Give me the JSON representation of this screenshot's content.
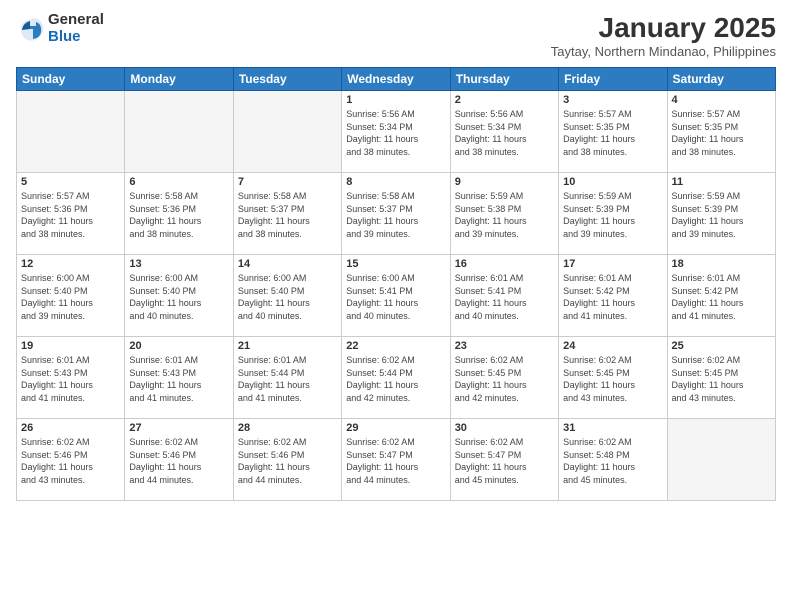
{
  "header": {
    "logo_general": "General",
    "logo_blue": "Blue",
    "month_title": "January 2025",
    "location": "Taytay, Northern Mindanao, Philippines"
  },
  "weekdays": [
    "Sunday",
    "Monday",
    "Tuesday",
    "Wednesday",
    "Thursday",
    "Friday",
    "Saturday"
  ],
  "weeks": [
    [
      {
        "day": "",
        "info": ""
      },
      {
        "day": "",
        "info": ""
      },
      {
        "day": "",
        "info": ""
      },
      {
        "day": "1",
        "info": "Sunrise: 5:56 AM\nSunset: 5:34 PM\nDaylight: 11 hours\nand 38 minutes."
      },
      {
        "day": "2",
        "info": "Sunrise: 5:56 AM\nSunset: 5:34 PM\nDaylight: 11 hours\nand 38 minutes."
      },
      {
        "day": "3",
        "info": "Sunrise: 5:57 AM\nSunset: 5:35 PM\nDaylight: 11 hours\nand 38 minutes."
      },
      {
        "day": "4",
        "info": "Sunrise: 5:57 AM\nSunset: 5:35 PM\nDaylight: 11 hours\nand 38 minutes."
      }
    ],
    [
      {
        "day": "5",
        "info": "Sunrise: 5:57 AM\nSunset: 5:36 PM\nDaylight: 11 hours\nand 38 minutes."
      },
      {
        "day": "6",
        "info": "Sunrise: 5:58 AM\nSunset: 5:36 PM\nDaylight: 11 hours\nand 38 minutes."
      },
      {
        "day": "7",
        "info": "Sunrise: 5:58 AM\nSunset: 5:37 PM\nDaylight: 11 hours\nand 38 minutes."
      },
      {
        "day": "8",
        "info": "Sunrise: 5:58 AM\nSunset: 5:37 PM\nDaylight: 11 hours\nand 39 minutes."
      },
      {
        "day": "9",
        "info": "Sunrise: 5:59 AM\nSunset: 5:38 PM\nDaylight: 11 hours\nand 39 minutes."
      },
      {
        "day": "10",
        "info": "Sunrise: 5:59 AM\nSunset: 5:39 PM\nDaylight: 11 hours\nand 39 minutes."
      },
      {
        "day": "11",
        "info": "Sunrise: 5:59 AM\nSunset: 5:39 PM\nDaylight: 11 hours\nand 39 minutes."
      }
    ],
    [
      {
        "day": "12",
        "info": "Sunrise: 6:00 AM\nSunset: 5:40 PM\nDaylight: 11 hours\nand 39 minutes."
      },
      {
        "day": "13",
        "info": "Sunrise: 6:00 AM\nSunset: 5:40 PM\nDaylight: 11 hours\nand 40 minutes."
      },
      {
        "day": "14",
        "info": "Sunrise: 6:00 AM\nSunset: 5:40 PM\nDaylight: 11 hours\nand 40 minutes."
      },
      {
        "day": "15",
        "info": "Sunrise: 6:00 AM\nSunset: 5:41 PM\nDaylight: 11 hours\nand 40 minutes."
      },
      {
        "day": "16",
        "info": "Sunrise: 6:01 AM\nSunset: 5:41 PM\nDaylight: 11 hours\nand 40 minutes."
      },
      {
        "day": "17",
        "info": "Sunrise: 6:01 AM\nSunset: 5:42 PM\nDaylight: 11 hours\nand 41 minutes."
      },
      {
        "day": "18",
        "info": "Sunrise: 6:01 AM\nSunset: 5:42 PM\nDaylight: 11 hours\nand 41 minutes."
      }
    ],
    [
      {
        "day": "19",
        "info": "Sunrise: 6:01 AM\nSunset: 5:43 PM\nDaylight: 11 hours\nand 41 minutes."
      },
      {
        "day": "20",
        "info": "Sunrise: 6:01 AM\nSunset: 5:43 PM\nDaylight: 11 hours\nand 41 minutes."
      },
      {
        "day": "21",
        "info": "Sunrise: 6:01 AM\nSunset: 5:44 PM\nDaylight: 11 hours\nand 41 minutes."
      },
      {
        "day": "22",
        "info": "Sunrise: 6:02 AM\nSunset: 5:44 PM\nDaylight: 11 hours\nand 42 minutes."
      },
      {
        "day": "23",
        "info": "Sunrise: 6:02 AM\nSunset: 5:45 PM\nDaylight: 11 hours\nand 42 minutes."
      },
      {
        "day": "24",
        "info": "Sunrise: 6:02 AM\nSunset: 5:45 PM\nDaylight: 11 hours\nand 43 minutes."
      },
      {
        "day": "25",
        "info": "Sunrise: 6:02 AM\nSunset: 5:45 PM\nDaylight: 11 hours\nand 43 minutes."
      }
    ],
    [
      {
        "day": "26",
        "info": "Sunrise: 6:02 AM\nSunset: 5:46 PM\nDaylight: 11 hours\nand 43 minutes."
      },
      {
        "day": "27",
        "info": "Sunrise: 6:02 AM\nSunset: 5:46 PM\nDaylight: 11 hours\nand 44 minutes."
      },
      {
        "day": "28",
        "info": "Sunrise: 6:02 AM\nSunset: 5:46 PM\nDaylight: 11 hours\nand 44 minutes."
      },
      {
        "day": "29",
        "info": "Sunrise: 6:02 AM\nSunset: 5:47 PM\nDaylight: 11 hours\nand 44 minutes."
      },
      {
        "day": "30",
        "info": "Sunrise: 6:02 AM\nSunset: 5:47 PM\nDaylight: 11 hours\nand 45 minutes."
      },
      {
        "day": "31",
        "info": "Sunrise: 6:02 AM\nSunset: 5:48 PM\nDaylight: 11 hours\nand 45 minutes."
      },
      {
        "day": "",
        "info": ""
      }
    ]
  ]
}
